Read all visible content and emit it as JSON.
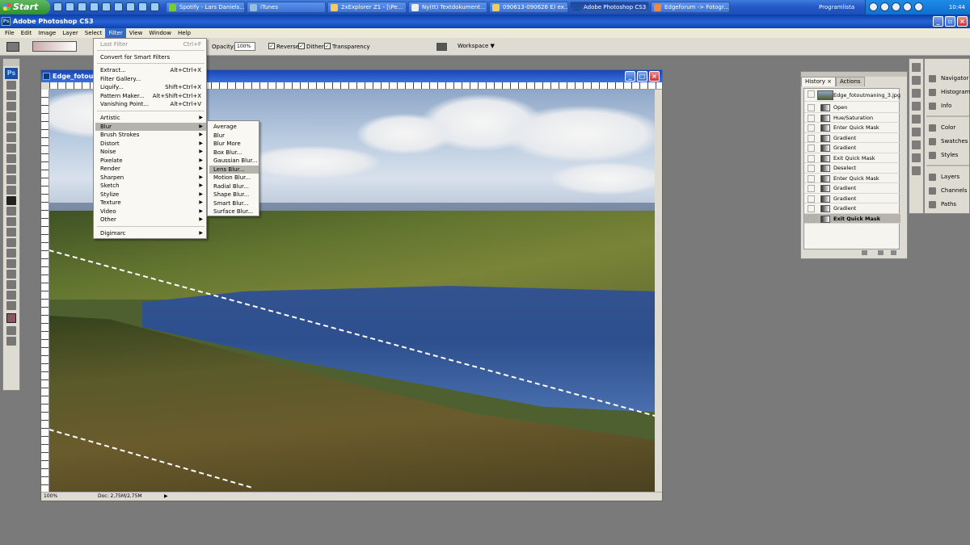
{
  "taskbar": {
    "start_label": "Start",
    "buttons": [
      {
        "label": "Spotify - Lars Daniels..."
      },
      {
        "label": "iTunes"
      },
      {
        "label": "2xExplorer Z1 - [\\Pe..."
      },
      {
        "label": "Ny(tt) Textdokument..."
      },
      {
        "label": "090613-090626 E) ex..."
      },
      {
        "label": "Adobe Photoshop CS3"
      },
      {
        "label": "Edgeforum -> Fotogr..."
      }
    ],
    "programlista": "Programlista",
    "clock": "10:44"
  },
  "app": {
    "title": "Adobe Photoshop CS3"
  },
  "menubar": [
    "File",
    "Edit",
    "Image",
    "Layer",
    "Select",
    "Filter",
    "View",
    "Window",
    "Help"
  ],
  "options": {
    "opacity_label": "Opacity:",
    "opacity_value": "100%",
    "reverse": "Reverse",
    "dither": "Dither",
    "transparency": "Transparency",
    "workspace": "Workspace ▼"
  },
  "document": {
    "title": "Edge_fotoutr",
    "zoom": "100%",
    "doc_info": "Doc: 2,75M/2,75M"
  },
  "filter_menu": {
    "last_filter": "Last Filter",
    "last_filter_shortcut": "Ctrl+F",
    "convert": "Convert for Smart Filters",
    "items1": [
      {
        "label": "Extract...",
        "shortcut": "Alt+Ctrl+X"
      },
      {
        "label": "Filter Gallery...",
        "shortcut": ""
      },
      {
        "label": "Liquify...",
        "shortcut": "Shift+Ctrl+X"
      },
      {
        "label": "Pattern Maker...",
        "shortcut": "Alt+Shift+Ctrl+X"
      },
      {
        "label": "Vanishing Point...",
        "shortcut": "Alt+Ctrl+V"
      }
    ],
    "items2": [
      "Artistic",
      "Blur",
      "Brush Strokes",
      "Distort",
      "Noise",
      "Pixelate",
      "Render",
      "Sharpen",
      "Sketch",
      "Stylize",
      "Texture",
      "Video",
      "Other"
    ],
    "digimarc": "Digimarc"
  },
  "blur_submenu": [
    "Average",
    "Blur",
    "Blur More",
    "Box Blur...",
    "Gaussian Blur...",
    "Lens Blur...",
    "Motion Blur...",
    "Radial Blur...",
    "Shape Blur...",
    "Smart Blur...",
    "Surface Blur..."
  ],
  "history_panel": {
    "tab_history": "History ×",
    "tab_actions": "Actions",
    "snapshot": "Edge_fotoutmaning_3.jpg",
    "steps": [
      "Open",
      "Hue/Saturation",
      "Enter Quick Mask",
      "Gradient",
      "Gradient",
      "Exit Quick Mask",
      "Deselect",
      "Enter Quick Mask",
      "Gradient",
      "Gradient",
      "Gradient",
      "Exit Quick Mask"
    ]
  },
  "side_panels": [
    "Navigator",
    "Histogram",
    "Info",
    "Color",
    "Swatches",
    "Styles",
    "Layers",
    "Channels",
    "Paths"
  ]
}
